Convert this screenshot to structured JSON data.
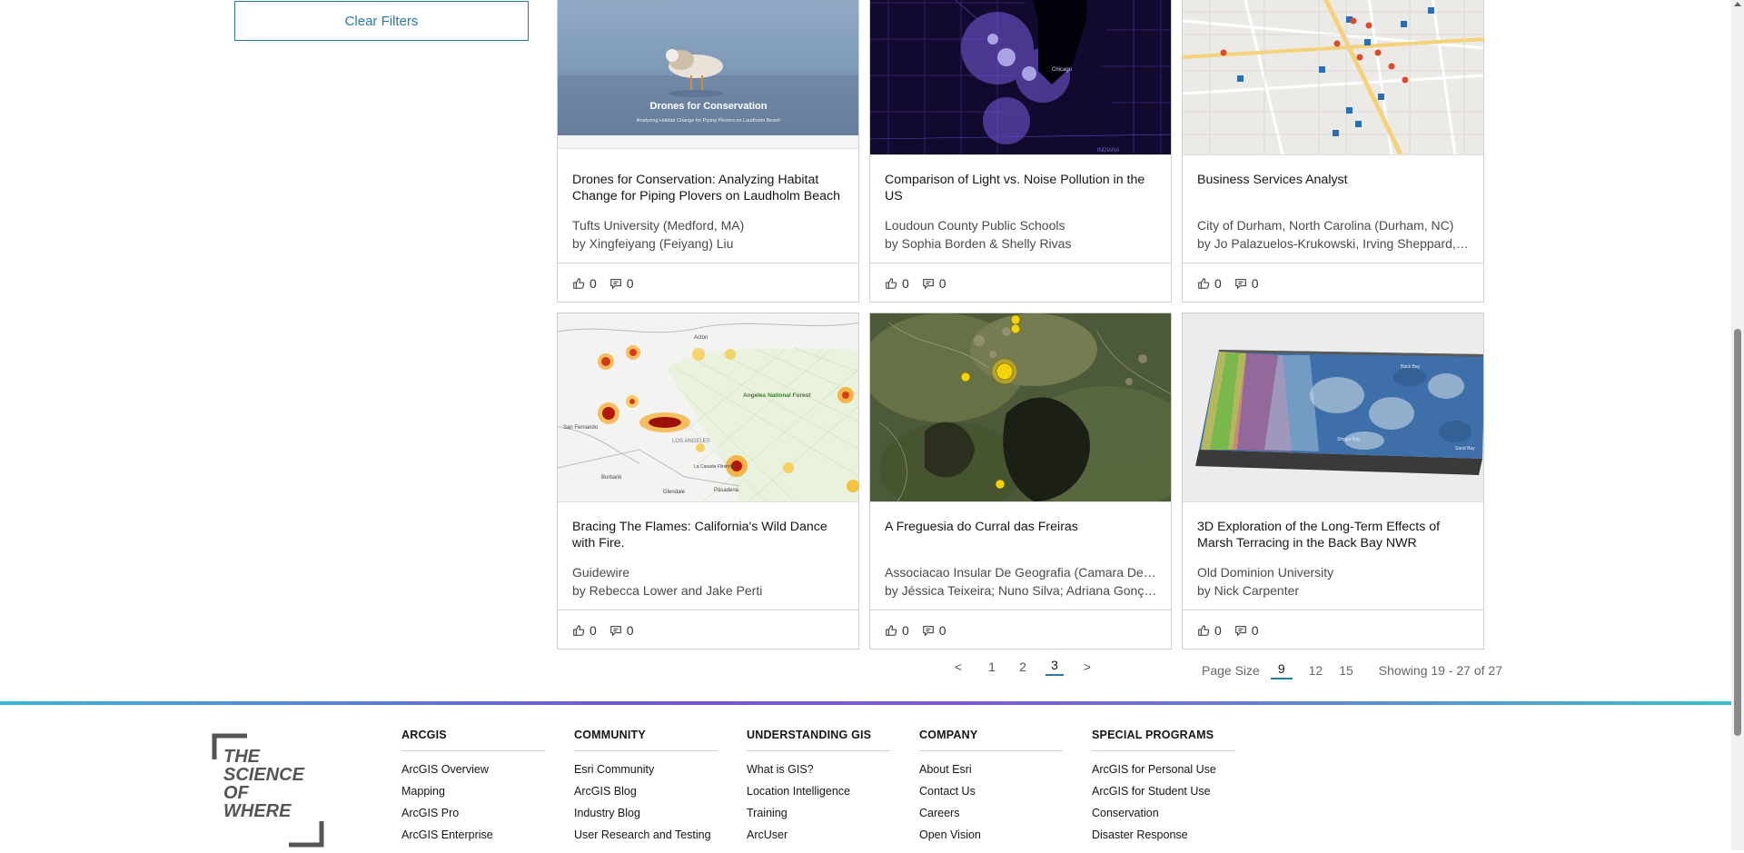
{
  "filters": {
    "clear_label": "Clear Filters"
  },
  "cards": [
    {
      "title": "Drones for Conservation: Analyzing Habitat Change for Piping Plovers on Laudholm Beach",
      "org": "Tufts University (Medford, MA)",
      "authors": "by Xingfeiyang (Feiyang) Liu",
      "likes": "0",
      "comments": "0",
      "thumb_title": "Drones for Conservation",
      "thumb_subtitle": "Analyzing Habitat Change for Piping Plovers on Laudholm Beach"
    },
    {
      "title": "Comparison of Light vs. Noise Pollution in the US",
      "org": "Loudoun County Public Schools",
      "authors": "by Sophia Borden & Shelly Rivas",
      "likes": "0",
      "comments": "0",
      "map_label_city": "Chicago",
      "map_label_state": "INDIANA"
    },
    {
      "title": "Business Services Analyst",
      "org": "City of Durham, North Carolina (Durham, NC)",
      "authors": "by Jo Palazuelos-Krukowski, Irving Sheppard, Wesley Parham",
      "likes": "0",
      "comments": "0"
    },
    {
      "title": "Bracing The Flames: California's Wild Dance with Fire.",
      "org": "Guidewire",
      "authors": "by Rebecca Lower and Jake Perti",
      "likes": "0",
      "comments": "0",
      "map_labels": [
        "Angeles National Forest",
        "LOS ANGELES",
        "Burbank",
        "Glendale",
        "Pasadena",
        "San Fernando",
        "Acton",
        "La Canada Flintridge"
      ]
    },
    {
      "title": "A Freguesia do Curral das Freiras",
      "org": "Associacao Insular De Geografia (Camara De Lobos, Madeira)",
      "authors": "by Jéssica Teixeira; Nuno Silva; Adriana Gonçalves",
      "likes": "0",
      "comments": "0"
    },
    {
      "title": "3D Exploration of the Long-Term Effects of Marsh Terracing in the Back Bay NWR",
      "org": "Old Dominion University",
      "authors": "by Nick Carpenter",
      "likes": "0",
      "comments": "0",
      "map_labels": [
        "Back Bay",
        "Shipps Bay",
        "Sand Bay"
      ]
    }
  ],
  "pagination": {
    "prev": "<",
    "pages": [
      "1",
      "2",
      "3"
    ],
    "current": "3",
    "next": ">"
  },
  "page_size": {
    "label": "Page Size",
    "options": [
      "9",
      "12",
      "15"
    ],
    "selected": "9",
    "showing": "Showing 19 - 27 of 27"
  },
  "footer": {
    "logo_lines": [
      "THE",
      "SCIENCE",
      "OF",
      "WHERE"
    ],
    "columns": [
      {
        "heading": "ARCGIS",
        "links": [
          "ArcGIS Overview",
          "Mapping",
          "ArcGIS Pro",
          "ArcGIS Enterprise"
        ]
      },
      {
        "heading": "COMMUNITY",
        "links": [
          "Esri Community",
          "ArcGIS Blog",
          "Industry Blog",
          "User Research and Testing"
        ]
      },
      {
        "heading": "UNDERSTANDING GIS",
        "links": [
          "What is GIS?",
          "Location Intelligence",
          "Training",
          "ArcUser"
        ]
      },
      {
        "heading": "COMPANY",
        "links": [
          "About Esri",
          "Contact Us",
          "Careers",
          "Open Vision"
        ]
      },
      {
        "heading": "SPECIAL PROGRAMS",
        "links": [
          "ArcGIS for Personal Use",
          "ArcGIS for Student Use",
          "Conservation",
          "Disaster Response"
        ]
      }
    ]
  },
  "colors": {
    "accent": "#2b7a9e",
    "text": "#151515",
    "muted": "#4a4a4a",
    "border": "#cfcfcf"
  },
  "icons": {
    "like": "thumbs-up-icon",
    "comment": "comment-icon"
  }
}
